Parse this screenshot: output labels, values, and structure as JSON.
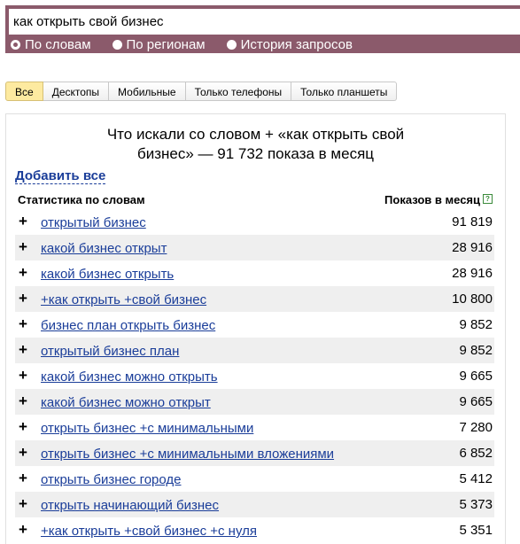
{
  "search": {
    "query": "как открыть свой бизнес",
    "modes": [
      {
        "label": "По словам",
        "checked": true
      },
      {
        "label": "По регионам",
        "checked": false
      },
      {
        "label": "История запросов",
        "checked": false
      }
    ]
  },
  "device_tabs": [
    {
      "label": "Все",
      "active": true
    },
    {
      "label": "Десктопы",
      "active": false
    },
    {
      "label": "Мобильные",
      "active": false
    },
    {
      "label": "Только телефоны",
      "active": false
    },
    {
      "label": "Только планшеты",
      "active": false
    }
  ],
  "panel": {
    "title": "Что искали со словом + «как открыть свой бизнес» — 91 732 показа в месяц",
    "add_all_label": "Добавить все",
    "col_words": "Статистика по словам",
    "col_count": "Показов в месяц",
    "help_glyph": "?",
    "plus_glyph": "+",
    "rows": [
      {
        "phrase": "открытый бизнес",
        "count": "91 819"
      },
      {
        "phrase": "какой бизнес открыт",
        "count": "28 916"
      },
      {
        "phrase": "какой бизнес открыть",
        "count": "28 916"
      },
      {
        "phrase": "+как открыть +свой бизнес",
        "count": "10 800"
      },
      {
        "phrase": "бизнес план открыть бизнес",
        "count": "9 852"
      },
      {
        "phrase": "открытый бизнес план",
        "count": "9 852"
      },
      {
        "phrase": "какой бизнес можно открыть",
        "count": "9 665"
      },
      {
        "phrase": "какой бизнес можно открыт",
        "count": "9 665"
      },
      {
        "phrase": "открыть бизнес +с минимальными",
        "count": "7 280"
      },
      {
        "phrase": "открыть бизнес +с минимальными вложениями",
        "count": "6 852"
      },
      {
        "phrase": "открыть бизнес городе",
        "count": "5 412"
      },
      {
        "phrase": "открыть начинающий бизнес",
        "count": "5 373"
      },
      {
        "phrase": "+как открыть +свой бизнес +с нуля",
        "count": "5 351"
      }
    ]
  }
}
